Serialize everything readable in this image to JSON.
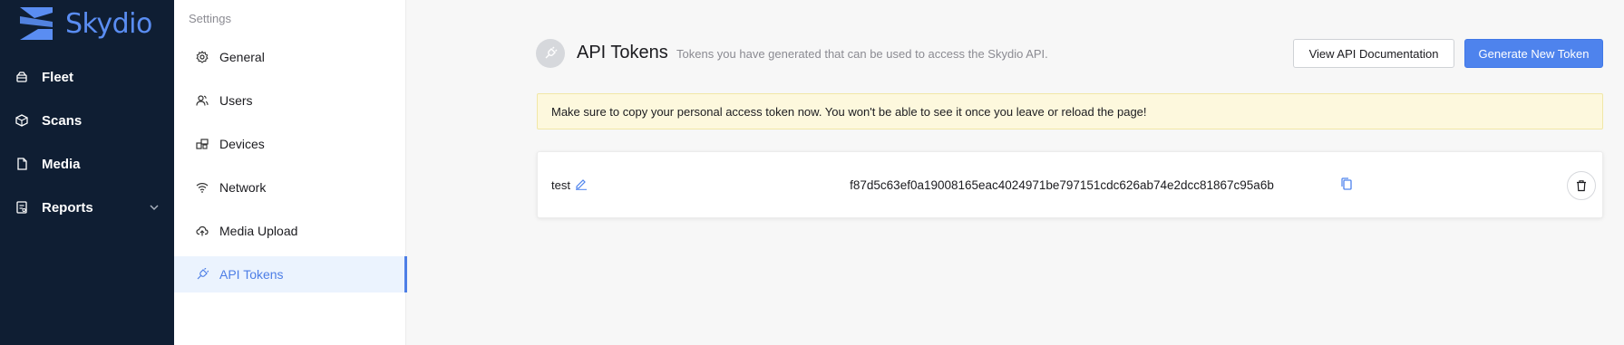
{
  "brand": {
    "name": "Skydio",
    "color": "#5a8df2"
  },
  "nav": {
    "items": [
      {
        "label": "Fleet",
        "icon": "fleet-icon"
      },
      {
        "label": "Scans",
        "icon": "scans-icon"
      },
      {
        "label": "Media",
        "icon": "media-icon"
      },
      {
        "label": "Reports",
        "icon": "reports-icon",
        "expandable": true
      }
    ]
  },
  "settings": {
    "title": "Settings",
    "items": [
      {
        "label": "General",
        "icon": "gear-icon"
      },
      {
        "label": "Users",
        "icon": "users-icon"
      },
      {
        "label": "Devices",
        "icon": "devices-icon"
      },
      {
        "label": "Network",
        "icon": "wifi-icon"
      },
      {
        "label": "Media Upload",
        "icon": "cloud-upload-icon"
      },
      {
        "label": "API Tokens",
        "icon": "plug-icon",
        "active": true
      }
    ]
  },
  "main": {
    "title": "API Tokens",
    "subtitle": "Tokens you have generated that can be used to access the Skydio API.",
    "view_docs_label": "View API Documentation",
    "generate_label": "Generate New Token",
    "warning": "Make sure to copy your personal access token now. You won't be able to see it once you leave or reload the page!",
    "tokens": [
      {
        "name": "test",
        "value": "f87d5c63ef0a19008165eac4024971be797151cdc626ab74e2dcc81867c95a6b"
      }
    ]
  },
  "colors": {
    "nav_bg": "#0f1e33",
    "accent": "#4e83ed",
    "warning_bg": "#fdf8dd"
  }
}
